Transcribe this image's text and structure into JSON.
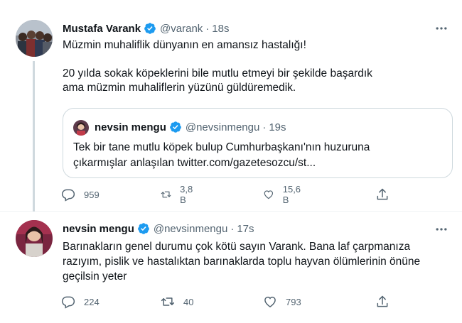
{
  "tweets": [
    {
      "author": {
        "name": "Mustafa Varank",
        "handle": "@varank",
        "time": "18s",
        "dot": "·"
      },
      "text": [
        "Müzmin muhaliflik dünyanın en amansız hastalığı!",
        "20 yılda sokak köpeklerini bile mutlu etmeyi bir şekilde başardık ama müzmin muhaliflerin yüzünü güldüremedik."
      ],
      "quote": {
        "author": {
          "name": "nevsin mengu",
          "handle": "@nevsinmengu",
          "time": "19s",
          "dot": "·"
        },
        "text": "Tek bir tane mutlu köpek bulup Cumhurbaşkanı'nın huzuruna çıkarmışlar anlaşılan twitter.com/gazetesozcu/st..."
      },
      "stats": {
        "replies": "959",
        "retweets": "3,8 B",
        "likes": "15,6 B"
      }
    },
    {
      "author": {
        "name": "nevsin mengu",
        "handle": "@nevsinmengu",
        "time": "17s",
        "dot": "·"
      },
      "text": [
        "Barınakların genel durumu çok kötü sayın Varank. Bana laf çarpmanıza razıyım, pislik ve hastalıktan barınaklarda toplu hayvan ölümlerinin önüne geçilsin yeter"
      ],
      "stats": {
        "replies": "224",
        "retweets": "40",
        "likes": "793"
      }
    }
  ],
  "colors": {
    "verified": "#1d9bf0",
    "secondary_text": "#536471",
    "border": "#cfd9de"
  },
  "icons": [
    "verified-badge-icon",
    "more-icon",
    "reply-icon",
    "retweet-icon",
    "like-icon",
    "share-icon"
  ]
}
